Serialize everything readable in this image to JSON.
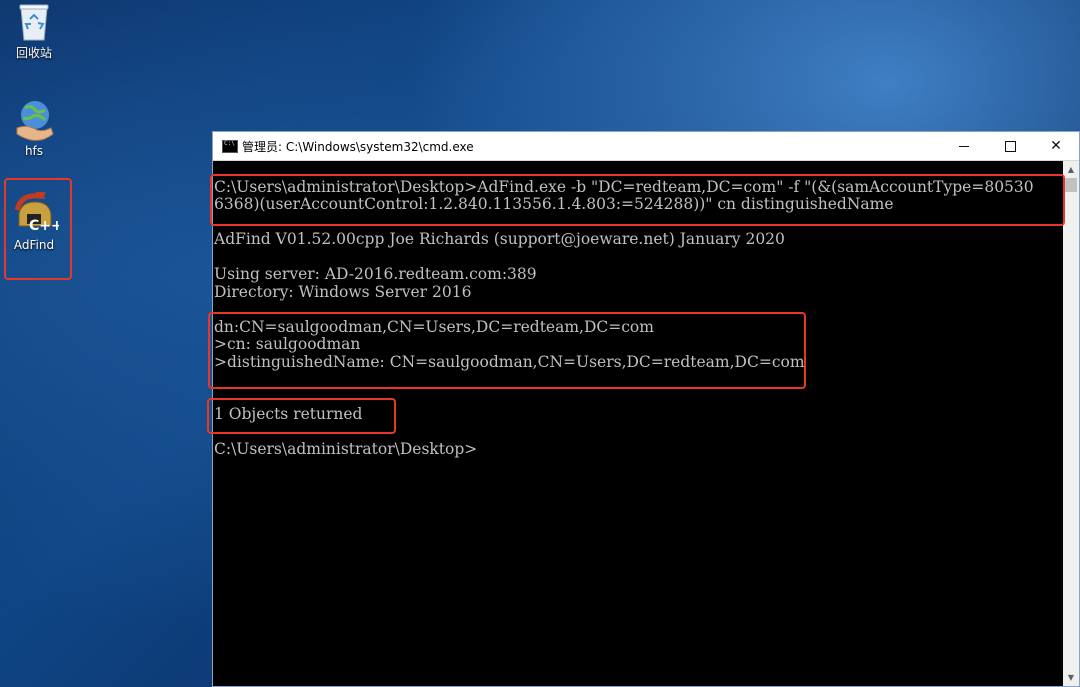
{
  "desktop": {
    "icons": [
      {
        "label": "回收站",
        "icon": "recycle-bin-icon"
      },
      {
        "label": "hfs",
        "icon": "globe-hand-icon"
      },
      {
        "label": "AdFind",
        "icon": "cpp-helmet-icon"
      }
    ]
  },
  "window": {
    "title": "管理员: C:\\Windows\\system32\\cmd.exe",
    "controls": {
      "minimize": "minimize",
      "maximize": "maximize",
      "close": "✕"
    }
  },
  "console": {
    "lines": [
      "C:\\Users\\administrator\\Desktop>AdFind.exe -b \"DC=redteam,DC=com\" -f \"(&(samAccountType=80530",
      "6368)(userAccountControl:1.2.840.113556.1.4.803:=524288))\" cn distinguishedName",
      "AdFind V01.52.00cpp Joe Richards (support@joeware.net) January 2020",
      "Using server: AD-2016.redteam.com:389",
      "Directory: Windows Server 2016",
      "dn:CN=saulgoodman,CN=Users,DC=redteam,DC=com",
      ">cn: saulgoodman",
      ">distinguishedName: CN=saulgoodman,CN=Users,DC=redteam,DC=com",
      "1 Objects returned",
      "C:\\Users\\administrator\\Desktop>"
    ]
  },
  "colors": {
    "highlight": "#e8362a",
    "console_bg": "#000000",
    "console_text": "#c0c0c0"
  }
}
